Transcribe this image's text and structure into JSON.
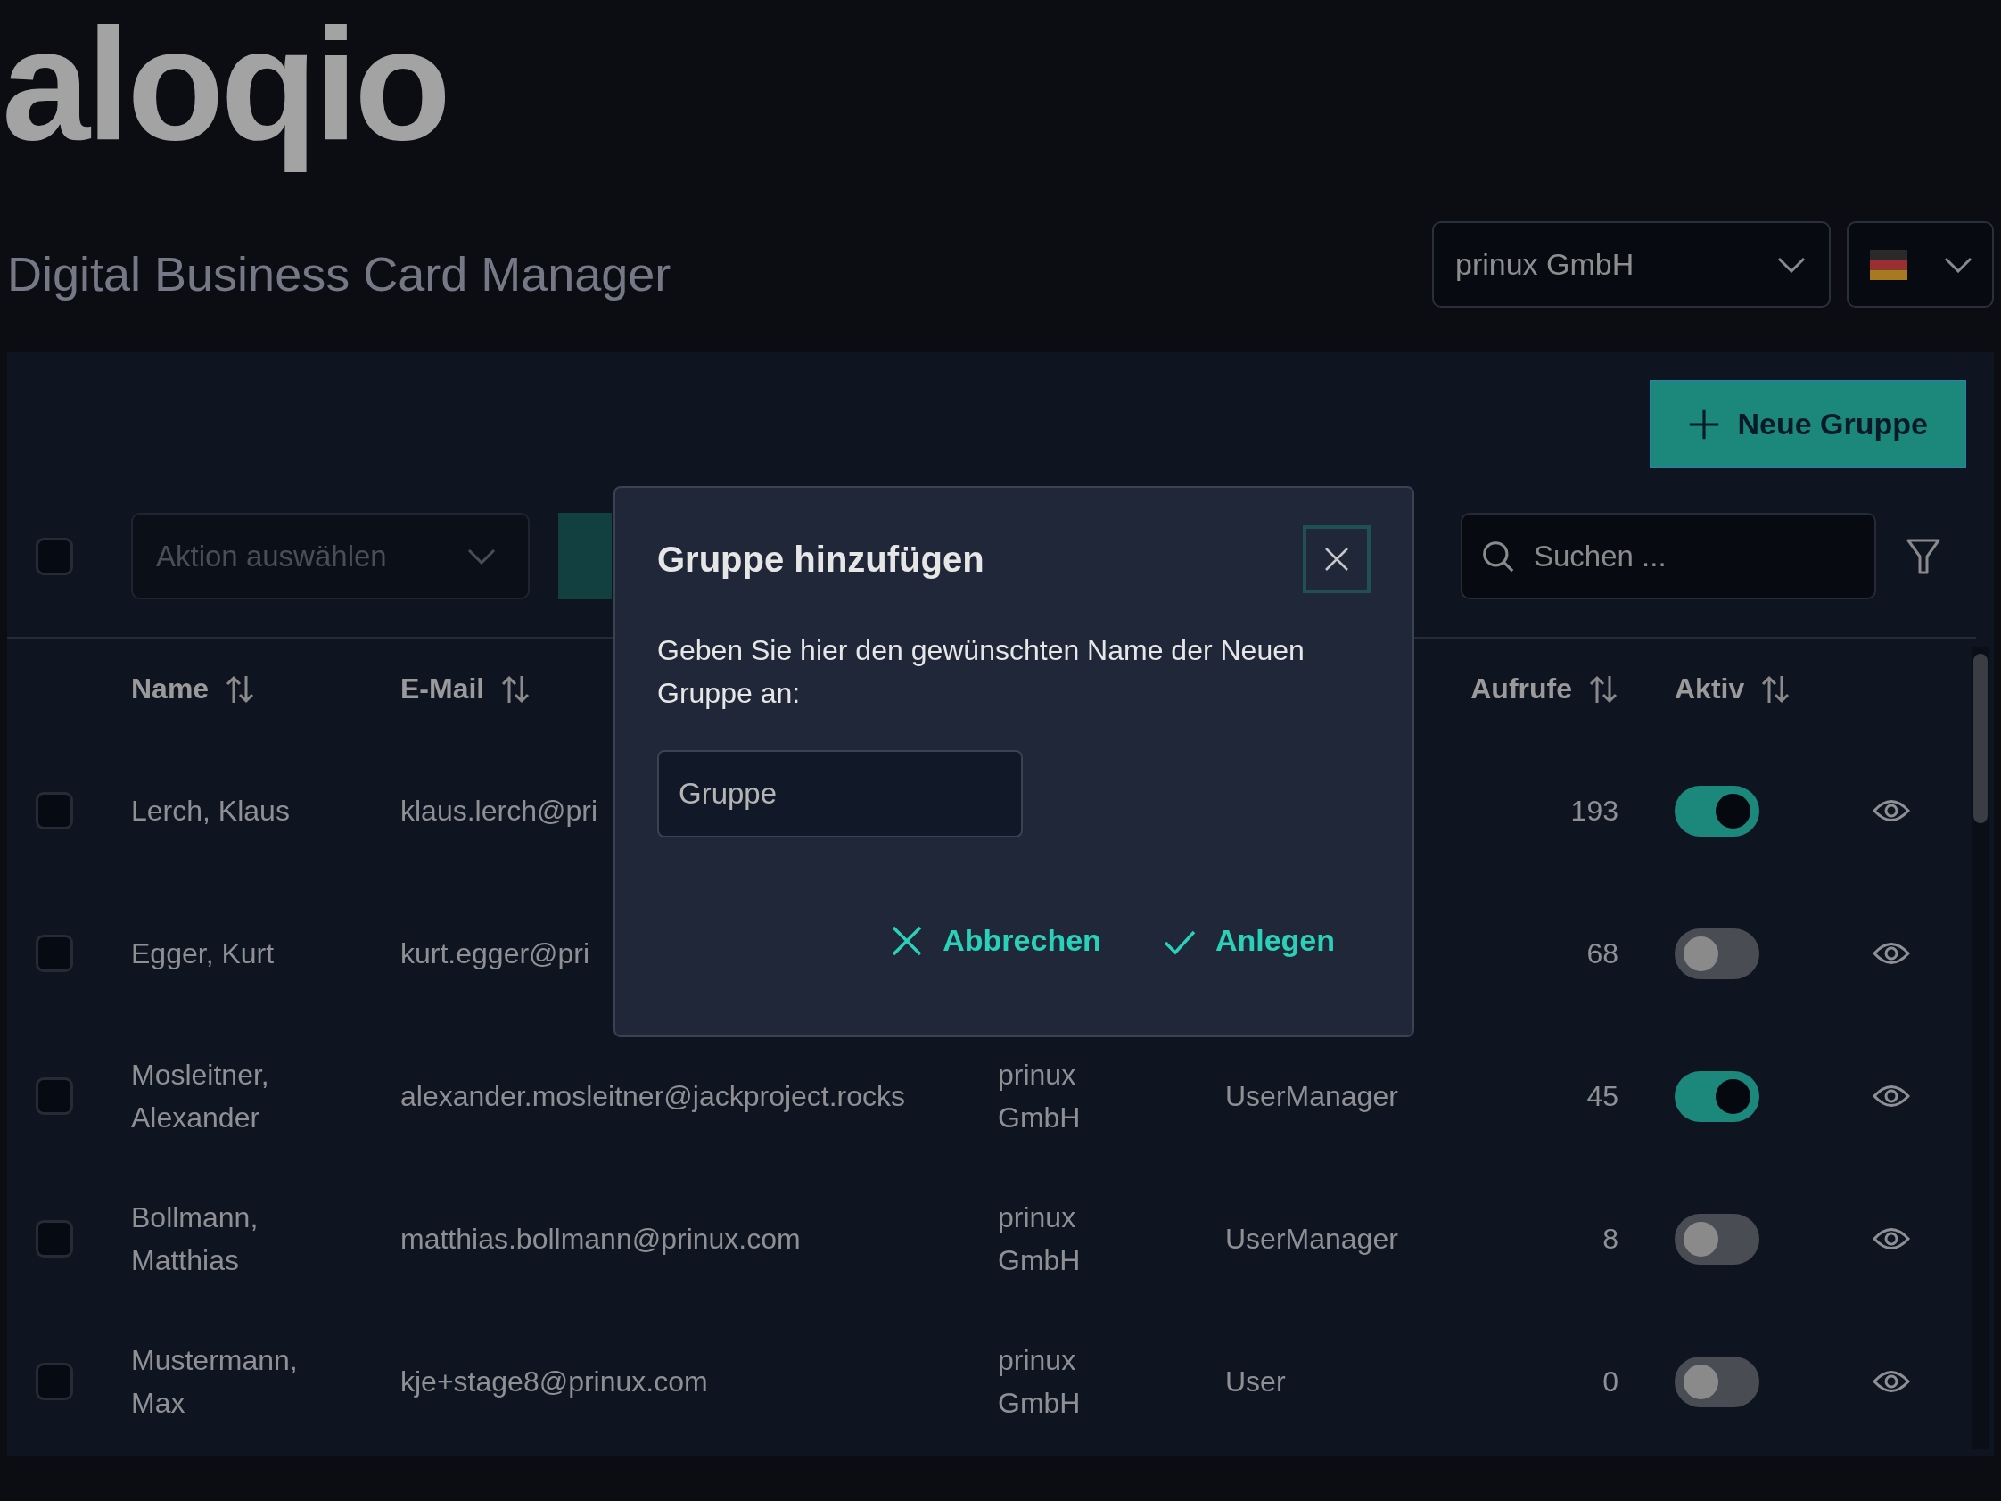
{
  "logo": "aloqio",
  "title": "Digital Business Card Manager",
  "company_select": {
    "value": "prinux GmbH"
  },
  "new_group_button": {
    "label": "Neue Gruppe"
  },
  "toolbar": {
    "select_all": {
      "checked": false
    },
    "action_select": {
      "placeholder": "Aktion auswählen"
    },
    "search": {
      "placeholder": "Suchen ..."
    }
  },
  "table": {
    "columns": [
      {
        "kind": "name",
        "label": "Name"
      },
      {
        "kind": "email",
        "label": "E-Mail"
      },
      {
        "kind": "views",
        "label": "Aufrufe"
      },
      {
        "kind": "active",
        "label": "Aktiv"
      }
    ],
    "rows": [
      {
        "checked": false,
        "name": "Lerch, Klaus",
        "email": "klaus.lerch@pri",
        "views": "193",
        "active": true
      },
      {
        "checked": false,
        "name": "Egger, Kurt",
        "email": "kurt.egger@pri",
        "views": "68",
        "active": false
      },
      {
        "checked": false,
        "name": "Mosleitner, Alexander",
        "email": "alexander.mosleitner@jackproject.rocks",
        "column_3": "prinux GmbH",
        "column_4": "UserManager",
        "views": "45",
        "active": true
      },
      {
        "checked": false,
        "name": "Bollmann, Matthias",
        "email": "matthias.bollmann@prinux.com",
        "column_3": "prinux GmbH",
        "column_4": "UserManager",
        "views": "8",
        "active": false
      },
      {
        "checked": false,
        "name": "Mustermann, Max",
        "email": "kje+stage8@prinux.com",
        "column_3": "prinux GmbH",
        "column_4": "User",
        "views": "0",
        "active": false
      }
    ]
  },
  "dialog": {
    "title": "Gruppe hinzufügen",
    "message": "Geben Sie hier den gewünschten Name der Neuen Gruppe an:",
    "input": {
      "placeholder": "Gruppe"
    },
    "buttons": [
      {
        "kind": "cancel",
        "label": "Abbrechen"
      },
      {
        "kind": "confirm",
        "label": "Anlegen"
      }
    ]
  }
}
